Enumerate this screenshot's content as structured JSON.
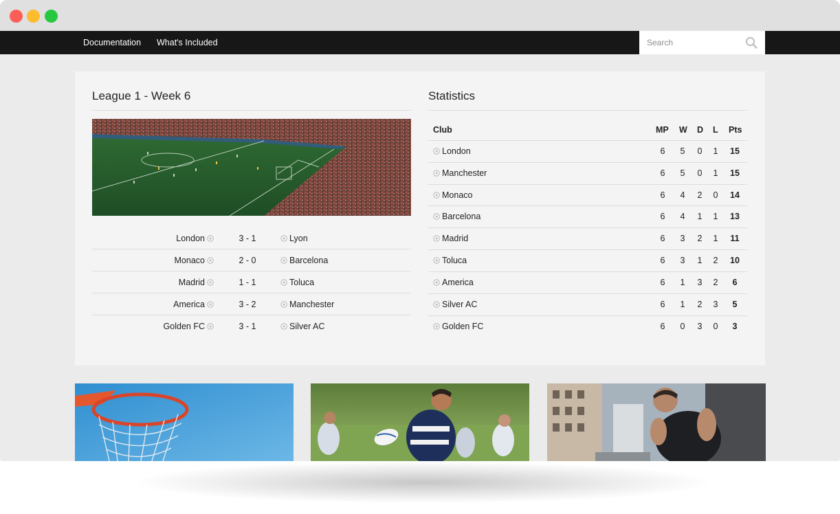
{
  "nav": {
    "links": [
      "Documentation",
      "What's Included"
    ],
    "search_placeholder": "Search"
  },
  "league": {
    "title": "League 1 - Week 6",
    "matches": [
      {
        "home": "London",
        "score": "3 - 1",
        "away": "Lyon"
      },
      {
        "home": "Monaco",
        "score": "2 - 0",
        "away": "Barcelona"
      },
      {
        "home": "Madrid",
        "score": "1 - 1",
        "away": "Toluca"
      },
      {
        "home": "America",
        "score": "3 - 2",
        "away": "Manchester"
      },
      {
        "home": "Golden FC",
        "score": "3 - 1",
        "away": "Silver AC"
      }
    ]
  },
  "stats": {
    "title": "Statistics",
    "headers": {
      "club": "Club",
      "mp": "MP",
      "w": "W",
      "d": "D",
      "l": "L",
      "pts": "Pts"
    },
    "rows": [
      {
        "club": "London",
        "mp": "6",
        "w": "5",
        "d": "0",
        "l": "1",
        "pts": "15"
      },
      {
        "club": "Manchester",
        "mp": "6",
        "w": "5",
        "d": "0",
        "l": "1",
        "pts": "15"
      },
      {
        "club": "Monaco",
        "mp": "6",
        "w": "4",
        "d": "2",
        "l": "0",
        "pts": "14"
      },
      {
        "club": "Barcelona",
        "mp": "6",
        "w": "4",
        "d": "1",
        "l": "1",
        "pts": "13"
      },
      {
        "club": "Madrid",
        "mp": "6",
        "w": "3",
        "d": "2",
        "l": "1",
        "pts": "11"
      },
      {
        "club": "Toluca",
        "mp": "6",
        "w": "3",
        "d": "1",
        "l": "2",
        "pts": "10"
      },
      {
        "club": "America",
        "mp": "6",
        "w": "1",
        "d": "3",
        "l": "2",
        "pts": "6"
      },
      {
        "club": "Silver AC",
        "mp": "6",
        "w": "1",
        "d": "2",
        "l": "3",
        "pts": "5"
      },
      {
        "club": "Golden FC",
        "mp": "6",
        "w": "0",
        "d": "3",
        "l": "0",
        "pts": "3"
      }
    ]
  },
  "icons": {
    "window_controls": [
      "close-dot",
      "minimize-dot",
      "zoom-dot"
    ],
    "search": "search-icon",
    "team": "circle-play-icon"
  },
  "colors": {
    "navbar": "#171717",
    "panel": "#f4f4f4",
    "background": "#ebebeb"
  }
}
